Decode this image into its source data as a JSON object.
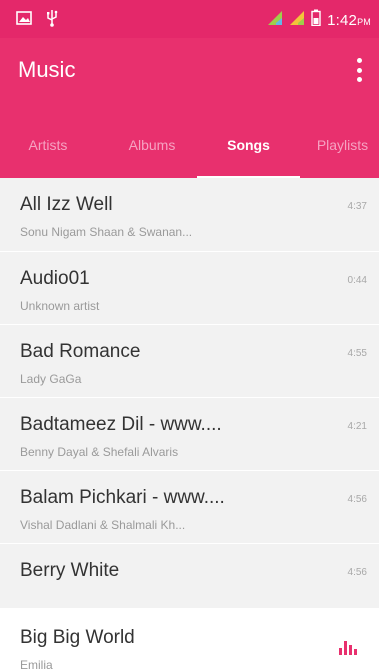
{
  "status_bar": {
    "time": "1:42",
    "time_suffix": "PM",
    "icons": [
      "image-icon",
      "usb-icon",
      "signal-icon-sim1",
      "signal-icon-sim2",
      "battery-icon"
    ]
  },
  "app_bar": {
    "title": "Music",
    "menu_icon": "overflow-menu-icon"
  },
  "tabs": [
    {
      "label": "Artists",
      "selected": false
    },
    {
      "label": "Albums",
      "selected": false
    },
    {
      "label": "Songs",
      "selected": true
    },
    {
      "label": "Playlists",
      "selected": false
    }
  ],
  "songs": [
    {
      "title": "All Izz Well",
      "artist": "Sonu Nigam Shaan & Swanan...",
      "duration": "4:37"
    },
    {
      "title": "Audio01",
      "artist": "Unknown artist",
      "duration": "0:44"
    },
    {
      "title": "Bad Romance",
      "artist": "Lady GaGa",
      "duration": "4:55"
    },
    {
      "title": "Badtameez Dil - www....",
      "artist": "Benny Dayal & Shefali Alvaris",
      "duration": "4:21"
    },
    {
      "title": "Balam Pichkari - www....",
      "artist": "Vishal Dadlani & Shalmali Kh...",
      "duration": "4:56"
    },
    {
      "title": "Berry White",
      "artist": "",
      "duration": "4:56"
    }
  ],
  "now_playing": {
    "title": "Big Big World",
    "artist": "Emilia",
    "icon": "equalizer-icon"
  },
  "colors": {
    "accent": "#e8306e",
    "status_bar": "#e4286a",
    "list_background": "#f2f2f2"
  }
}
